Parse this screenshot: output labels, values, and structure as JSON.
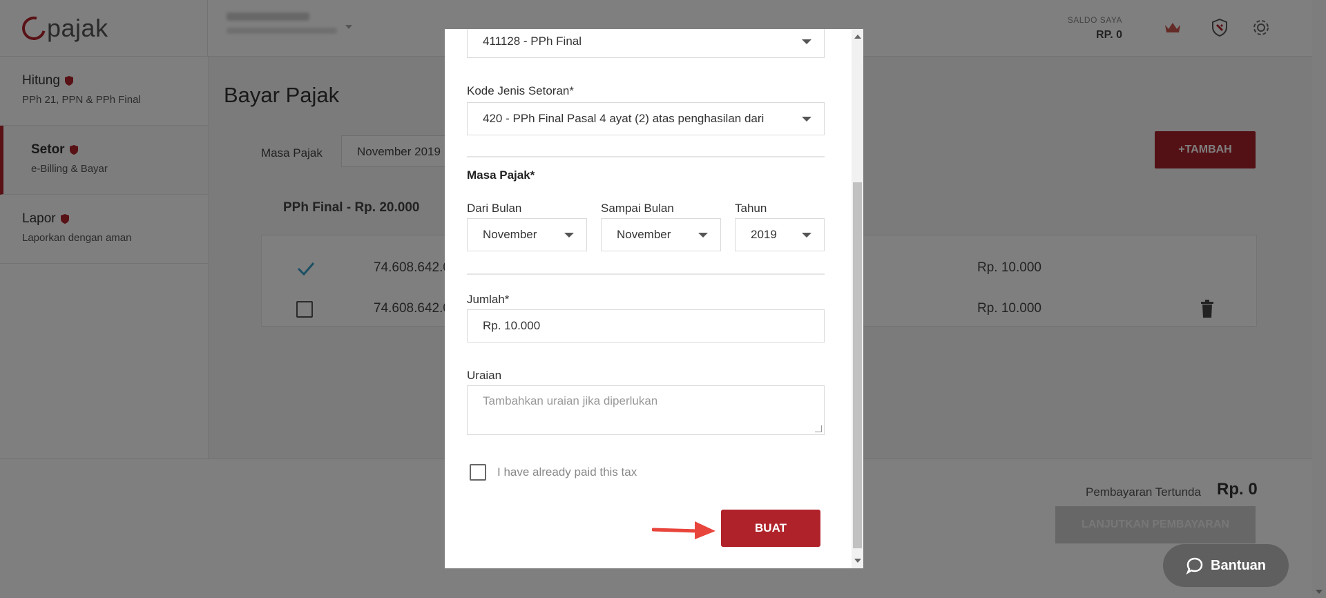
{
  "app": {
    "logo_text": "pajak"
  },
  "header": {
    "saldo_label": "SALDO SAYA",
    "saldo_value": "RP. 0"
  },
  "sidebar": {
    "items": [
      {
        "title": "Hitung",
        "subtitle": "PPh 21, PPN & PPh Final"
      },
      {
        "title": "Setor",
        "subtitle": "e-Billing & Bayar"
      },
      {
        "title": "Lapor",
        "subtitle": "Laporkan dengan aman"
      }
    ]
  },
  "main": {
    "page_title": "Bayar Pajak",
    "masa_label": "Masa Pajak",
    "masa_value": "November 2019",
    "tambah_label": "+TAMBAH",
    "summary": "PPh Final - Rp. 20.000",
    "rows": [
      {
        "npwp": "74.608.642.0",
        "amount": "Rp. 10.000"
      },
      {
        "npwp": "74.608.642.0",
        "amount": "Rp. 10.000"
      }
    ]
  },
  "footer": {
    "pending_label": "Pembayaran Tertunda",
    "pending_value": "Rp. 0",
    "continue_label": "LANJUTKAN PEMBAYARAN"
  },
  "help": {
    "label": "Bantuan"
  },
  "modal": {
    "akun_value": "411128 - PPh Final",
    "kode_label": "Kode Jenis Setoran*",
    "kode_value": "420 - PPh Final Pasal 4 ayat (2) atas penghasilan dari",
    "masa_title": "Masa Pajak*",
    "dari_label": "Dari Bulan",
    "dari_value": "November",
    "sampai_label": "Sampai Bulan",
    "sampai_value": "November",
    "tahun_label": "Tahun",
    "tahun_value": "2019",
    "jumlah_label": "Jumlah*",
    "jumlah_value": "Rp. 10.000",
    "uraian_label": "Uraian",
    "uraian_placeholder": "Tambahkan uraian jika diperlukan",
    "paid_label": "I have already paid this tax",
    "buat_label": "BUAT"
  },
  "colors": {
    "brand": "#b0222a",
    "accent_check": "#3aa0c8"
  }
}
